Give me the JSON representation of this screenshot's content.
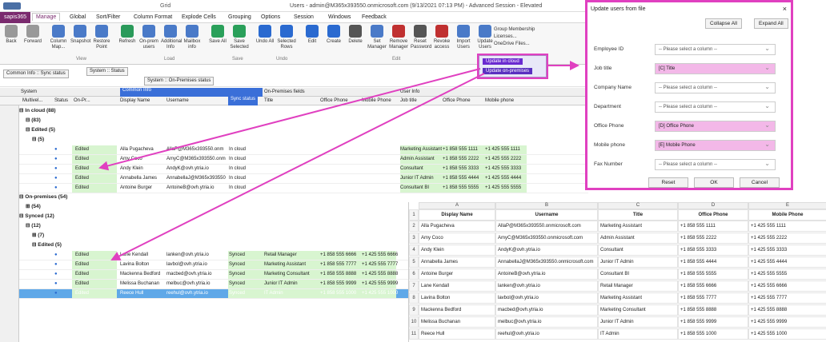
{
  "titlebar": {
    "context": "Grid",
    "window_title": "Users - admin@M365x393550.onmicrosoft.com (9/13/2021 07:13 PM) - Advanced Session - Elevated"
  },
  "menubar": {
    "brand": "sapis365",
    "items": [
      "Manage",
      "Global",
      "Sort/Filter",
      "Column Format",
      "Explode Cells",
      "Grouping",
      "Options",
      "Session",
      "Windows",
      "Feedback"
    ]
  },
  "ribbon": {
    "buttons": [
      {
        "label": "Back",
        "group": ""
      },
      {
        "label": "Forward",
        "group": ""
      },
      {
        "label": "Column Map...",
        "group": "View"
      },
      {
        "label": "Snapshot",
        "group": "View"
      },
      {
        "label": "Restore Point",
        "group": "View"
      },
      {
        "label": "Refresh",
        "group": "Load"
      },
      {
        "label": "On-prem users",
        "group": "Load"
      },
      {
        "label": "Additional Info",
        "group": "Load"
      },
      {
        "label": "Mailbox info",
        "group": "Load"
      },
      {
        "label": "Save All",
        "group": "Save"
      },
      {
        "label": "Save Selected",
        "group": "Save"
      },
      {
        "label": "Undo All",
        "group": "Undo"
      },
      {
        "label": "Selected Rows",
        "group": "Undo"
      },
      {
        "label": "Edit",
        "group": "Edit"
      },
      {
        "label": "Create",
        "group": "Edit"
      },
      {
        "label": "Delete",
        "group": "Edit"
      },
      {
        "label": "Set Manager",
        "group": "Edit"
      },
      {
        "label": "Remove Manager",
        "group": "Edit"
      },
      {
        "label": "Reset Password",
        "group": "Edit"
      },
      {
        "label": "Revoke access",
        "group": "Edit"
      },
      {
        "label": "Import Users",
        "group": "Edit"
      },
      {
        "label": "Update Users",
        "group": "Edit"
      }
    ],
    "groups": [
      "View",
      "Load",
      "Save",
      "Undo",
      "Edit"
    ],
    "side": [
      "Group Membership",
      "Licenses...",
      "OneDrive Files..."
    ]
  },
  "update_menu": [
    "Update in cloud",
    "Update on-premises"
  ],
  "filters": {
    "chip1": "Common Info :: Sync status",
    "chip2": "System :: Status",
    "chip3": "System :: On-Premises status"
  },
  "grid": {
    "bands": [
      "System",
      "Common Info",
      "On-Premises fields",
      "User Info"
    ],
    "columns": [
      "Multivel...",
      "Status",
      "On-Pr...",
      "Display Name",
      "Username",
      "Sync status",
      "Title",
      "Office Phone",
      "Mobile Phone",
      "Job title",
      "Office Phone",
      "Mobile phone"
    ],
    "groups": [
      {
        "label": "In cloud (88)"
      },
      {
        "label": "(83)"
      },
      {
        "label": "Edited (5)"
      },
      {
        "label": "(5)"
      },
      {
        "label": "On-premises (54)"
      },
      {
        "label": "(54)"
      },
      {
        "label": "Synced (12)"
      },
      {
        "label": "(12)"
      },
      {
        "label": "(7)"
      },
      {
        "label": "Edited (5)"
      }
    ],
    "cloud_rows": [
      {
        "status": "Edited",
        "name": "Alla Pugacheva",
        "user": "AllaP@M365x393550.onm",
        "sync": "In cloud",
        "job": "Marketing Assistant",
        "phone": "+1 858 555 1111",
        "mobile": "+1 425 555 1111"
      },
      {
        "status": "Edited",
        "name": "Amy Coco",
        "user": "AmyC@M365x393550.onm",
        "sync": "In cloud",
        "job": "Admin Assistant",
        "phone": "+1 858 555 2222",
        "mobile": "+1 425 555 2222"
      },
      {
        "status": "Edited",
        "name": "Andy Klein",
        "user": "AndyK@ovh.ytria.io",
        "sync": "In cloud",
        "job": "Consultant",
        "phone": "+1 858 555 3333",
        "mobile": "+1 425 555 3333"
      },
      {
        "status": "Edited",
        "name": "Annabella James",
        "user": "AnnabellaJ@M365x393550",
        "sync": "In cloud",
        "job": "Junior IT Admin",
        "phone": "+1 858 555 4444",
        "mobile": "+1 425 555 4444"
      },
      {
        "status": "Edited",
        "name": "Antoine Burger",
        "user": "AntoineB@ovh.ytria.io",
        "sync": "In cloud",
        "job": "Consultant BI",
        "phone": "+1 858 555 5555",
        "mobile": "+1 425 555 5555"
      }
    ],
    "synced_rows": [
      {
        "status": "Edited",
        "name": "Lane Kendall",
        "user": "lanken@ovh.ytria.io",
        "sync": "Synced",
        "title": "Retail Manager",
        "phone": "+1 858 555 6666",
        "mobile": "+1 425 555 6666"
      },
      {
        "status": "Edited",
        "name": "Lavina Bolton",
        "user": "lavbol@ovh.ytria.io",
        "sync": "Synced",
        "title": "Marketing Assistant",
        "phone": "+1 858 555 7777",
        "mobile": "+1 425 555 7777"
      },
      {
        "status": "Edited",
        "name": "Mackenna Bedford",
        "user": "macbed@ovh.ytria.io",
        "sync": "Synced",
        "title": "Marketing Consultant",
        "phone": "+1 858 555 8888",
        "mobile": "+1 425 555 8888"
      },
      {
        "status": "Edited",
        "name": "Melissa Buchanan",
        "user": "melbuc@ovh.ytria.io",
        "sync": "Synced",
        "title": "Junior IT Admin",
        "phone": "+1 858 555 9999",
        "mobile": "+1 425 555 9999"
      },
      {
        "status": "Edited",
        "name": "Reece Hull",
        "user": "reehul@ovh.ytria.io",
        "sync": "Synced",
        "title": "IT Admin",
        "phone": "+1 858 555 1000",
        "mobile": "+1 425 555 1000"
      }
    ]
  },
  "modal": {
    "title": "Update users from file",
    "collapse": "Collapse All",
    "expand": "Expand All",
    "fields": [
      {
        "label": "Employee ID",
        "value": "-- Please select a column --",
        "hl": false
      },
      {
        "label": "Job title",
        "value": "[C] Title",
        "hl": true
      },
      {
        "label": "Company Name",
        "value": "-- Please select a column --",
        "hl": false
      },
      {
        "label": "Department",
        "value": "-- Please select a column --",
        "hl": false
      },
      {
        "label": "Office Phone",
        "value": "[D] Office Phone",
        "hl": true
      },
      {
        "label": "Mobile phone",
        "value": "[E] Mobile Phone",
        "hl": true
      },
      {
        "label": "Fax Number",
        "value": "-- Please select a column --",
        "hl": false
      }
    ],
    "reset": "Reset",
    "ok": "OK",
    "cancel": "Cancel"
  },
  "sheet": {
    "cols": [
      "A",
      "B",
      "C",
      "D",
      "E"
    ],
    "headers": [
      "Display Name",
      "Username",
      "Title",
      "Office Phone",
      "Mobile Phone"
    ],
    "rows": [
      [
        "Alla Pugacheva",
        "AllaP@M365x393550.onmicrosoft.com",
        "Marketing Assistant",
        "+1 858 555 1111",
        "+1 425 555 1111"
      ],
      [
        "Amy Coco",
        "AmyC@M365x393550.onmicrosoft.com",
        "Admin Assistant",
        "+1 858 555 2222",
        "+1 425 555 2222"
      ],
      [
        "Andy Klein",
        "AndyK@ovh.ytria.io",
        "Consultant",
        "+1 858 555 3333",
        "+1 425 555 3333"
      ],
      [
        "Annabella James",
        "AnnabellaJ@M365x393550.onmicrosoft.com",
        "Junior IT Admin",
        "+1 858 555 4444",
        "+1 425 555 4444"
      ],
      [
        "Antoine Burger",
        "AntoineB@ovh.ytria.io",
        "Consultant BI",
        "+1 858 555 5555",
        "+1 425 555 5555"
      ],
      [
        "Lane Kendall",
        "lanken@ovh.ytria.io",
        "Retail Manager",
        "+1 858 555 6666",
        "+1 425 555 6666"
      ],
      [
        "Lavina Bolton",
        "lavbol@ovh.ytria.io",
        "Marketing Assistant",
        "+1 858 555 7777",
        "+1 425 555 7777"
      ],
      [
        "Mackenna Bedford",
        "macbed@ovh.ytria.io",
        "Marketing Consultant",
        "+1 858 555 8888",
        "+1 425 555 8888"
      ],
      [
        "Melissa Buchanan",
        "melbuc@ovh.ytria.io",
        "Junior IT Admin",
        "+1 858 555 9999",
        "+1 425 555 9999"
      ],
      [
        "Reece Hull",
        "reehul@ovh.ytria.io",
        "IT Admin",
        "+1 858 555 1000",
        "+1 425 555 1000"
      ]
    ]
  }
}
